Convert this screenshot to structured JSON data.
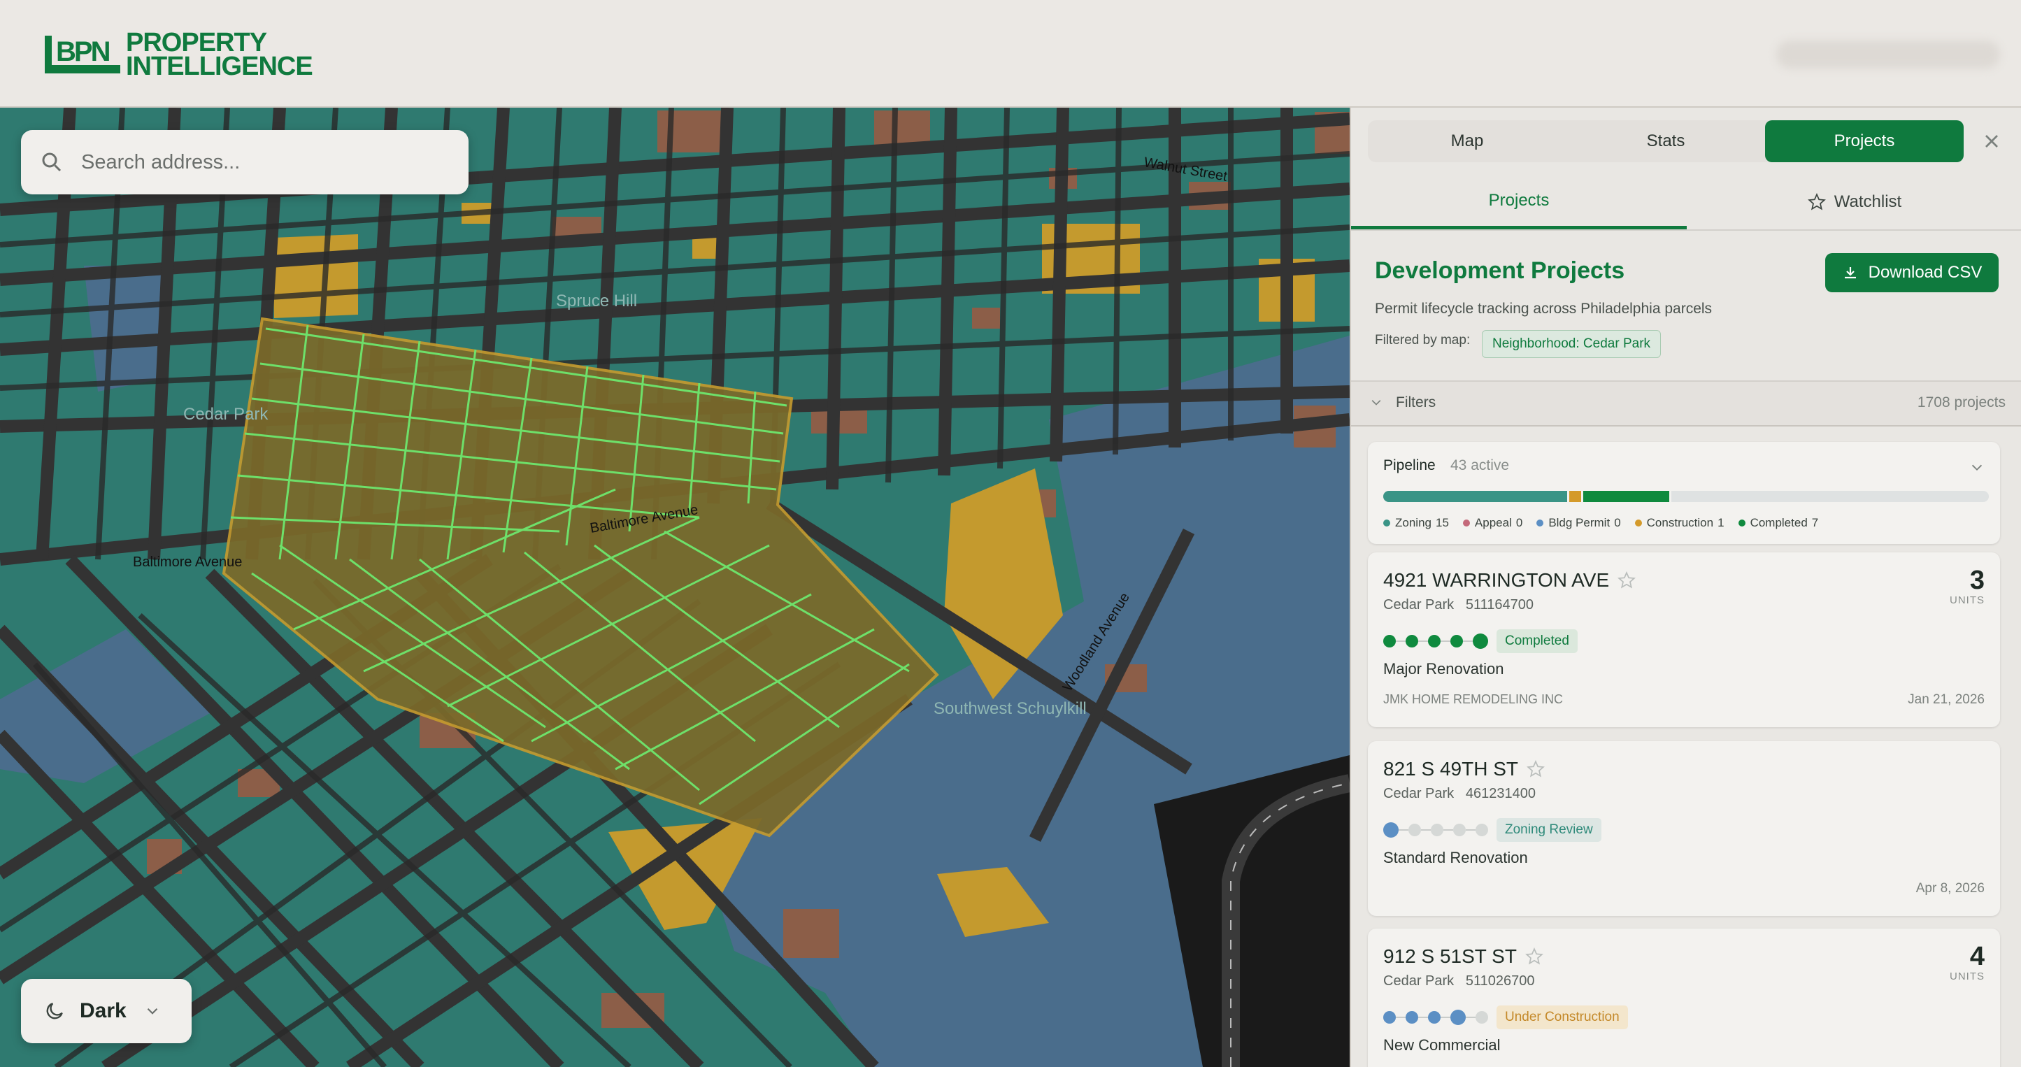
{
  "brand": {
    "mark": "BPN",
    "line1": "PROPERTY",
    "line2": "INTELLIGENCE",
    "color": "#0f7a3e"
  },
  "search": {
    "placeholder": "Search address..."
  },
  "theme_toggle": {
    "label": "Dark"
  },
  "map": {
    "street_labels": [
      "Walnut Street",
      "Spruce Hill",
      "Cedar Park",
      "Baltimore Avenue",
      "Baltimore Avenue",
      "Woodland Avenue",
      "Southwest Schuylkill"
    ],
    "colors": {
      "residential": "#2f7a70",
      "commercial": "#8c5e48",
      "vacant": "#c49a2e",
      "water": "#4a6d8c",
      "highlight": "#6ee06a",
      "road": "#333333"
    }
  },
  "panel": {
    "tabs": [
      "Map",
      "Stats",
      "Projects"
    ],
    "active_tab": "Projects",
    "subtabs": {
      "projects": "Projects",
      "watchlist": "Watchlist"
    },
    "title": "Development Projects",
    "download_label": "Download CSV",
    "subtitle": "Permit lifecycle tracking across Philadelphia parcels",
    "filtered_by_label": "Filtered by map:",
    "filter_chip": "Neighborhood: Cedar Park",
    "filters_label": "Filters",
    "project_count": "1708 projects",
    "pipeline": {
      "title": "Pipeline",
      "active": "43 active",
      "stages": [
        {
          "name": "Zoning",
          "count": "15",
          "value": 15,
          "color": "#3a9486"
        },
        {
          "name": "Appeal",
          "count": "0",
          "value": 0,
          "color": "#c4697a"
        },
        {
          "name": "Bldg Permit",
          "count": "0",
          "value": 0,
          "color": "#5b8fc4"
        },
        {
          "name": "Construction",
          "count": "1",
          "value": 1,
          "color": "#d49a2a"
        },
        {
          "name": "Completed",
          "count": "7",
          "value": 7,
          "color": "#0f8a3e"
        }
      ],
      "bar_fill_fraction": 0.465
    },
    "projects": [
      {
        "address": "4921 WARRINGTON AVE",
        "neighborhood": "Cedar Park",
        "parcel": "511164700",
        "units": "3",
        "units_label": "UNITS",
        "status": "Completed",
        "status_fg": "#0f7a3e",
        "status_bg": "#dbe8dc",
        "steps_done": 5,
        "step_color": "#0f8a3e",
        "type": "Major Renovation",
        "contractor": "JMK HOME REMODELING INC",
        "date": "Jan 21, 2026"
      },
      {
        "address": "821 S 49TH ST",
        "neighborhood": "Cedar Park",
        "parcel": "461231400",
        "units": "",
        "units_label": "",
        "status": "Zoning Review",
        "status_fg": "#2f8a7a",
        "status_bg": "#dde6e3",
        "steps_done": 1,
        "step_color": "#5b8fc4",
        "type": "Standard Renovation",
        "contractor": "",
        "date": "Apr 8, 2026"
      },
      {
        "address": "912 S 51ST ST",
        "neighborhood": "Cedar Park",
        "parcel": "511026700",
        "units": "4",
        "units_label": "UNITS",
        "status": "Under Construction",
        "status_fg": "#c4892a",
        "status_bg": "#f3e6cc",
        "steps_done": 4,
        "step_color": "#5b8fc4",
        "type": "New Commercial",
        "contractor": "",
        "date": ""
      }
    ]
  }
}
